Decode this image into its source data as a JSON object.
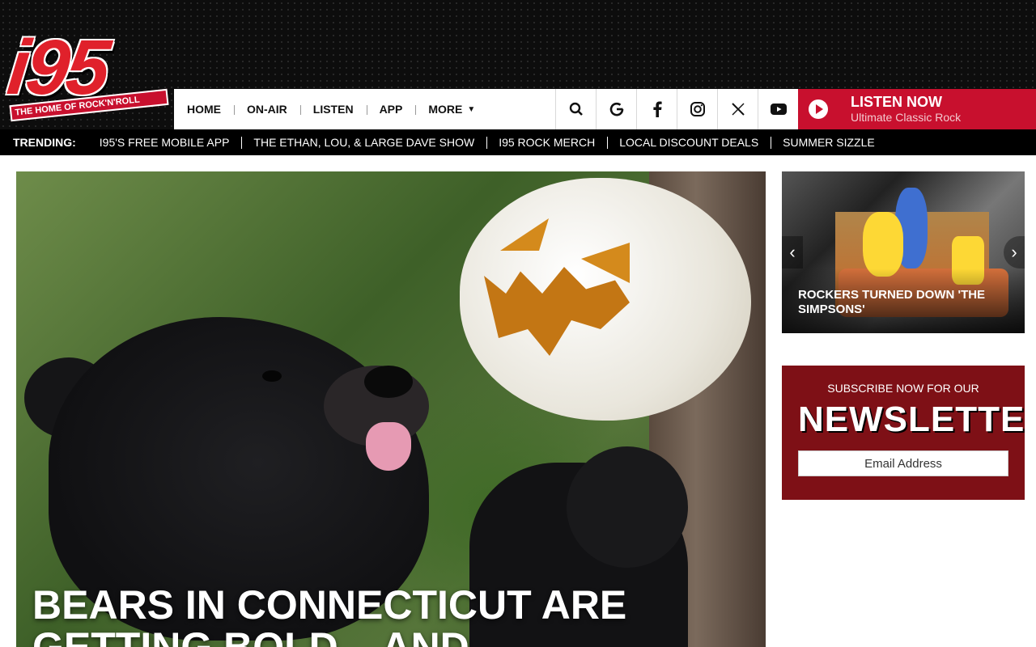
{
  "logo": {
    "number": "i95",
    "tagline": "THE HOME OF ROCK'N'ROLL"
  },
  "nav": {
    "items": [
      {
        "label": "HOME"
      },
      {
        "label": "ON-AIR"
      },
      {
        "label": "LISTEN"
      },
      {
        "label": "APP"
      },
      {
        "label": "MORE"
      }
    ]
  },
  "icons": [
    {
      "name": "search-icon",
      "glyph": "🔍"
    },
    {
      "name": "google-icon",
      "glyph": "G"
    },
    {
      "name": "facebook-icon",
      "glyph": "f"
    },
    {
      "name": "instagram-icon",
      "glyph": "◎"
    },
    {
      "name": "x-icon",
      "glyph": "𝕏"
    },
    {
      "name": "youtube-icon",
      "glyph": "▶"
    }
  ],
  "listen": {
    "title": "LISTEN NOW",
    "subtitle": "Ultimate Classic Rock"
  },
  "trending": {
    "label": "TRENDING:",
    "links": [
      "I95'S FREE MOBILE APP",
      "THE ETHAN, LOU, & LARGE DAVE SHOW",
      "I95 ROCK MERCH",
      "LOCAL DISCOUNT DEALS",
      "SUMMER SIZZLE"
    ]
  },
  "hero": {
    "title": "BEARS IN CONNECTICUT ARE GETTING BOLD... AND"
  },
  "carousel": {
    "caption": "ROCKERS TURNED DOWN 'THE SIMPSONS'"
  },
  "newsletter": {
    "pre": "SUBSCRIBE NOW FOR OUR",
    "big": "NEWSLETTER",
    "placeholder": "Email Address"
  },
  "colors": {
    "brand_red": "#c8102e",
    "newsletter_bg": "#7e1016",
    "trending_bg": "#000000"
  }
}
